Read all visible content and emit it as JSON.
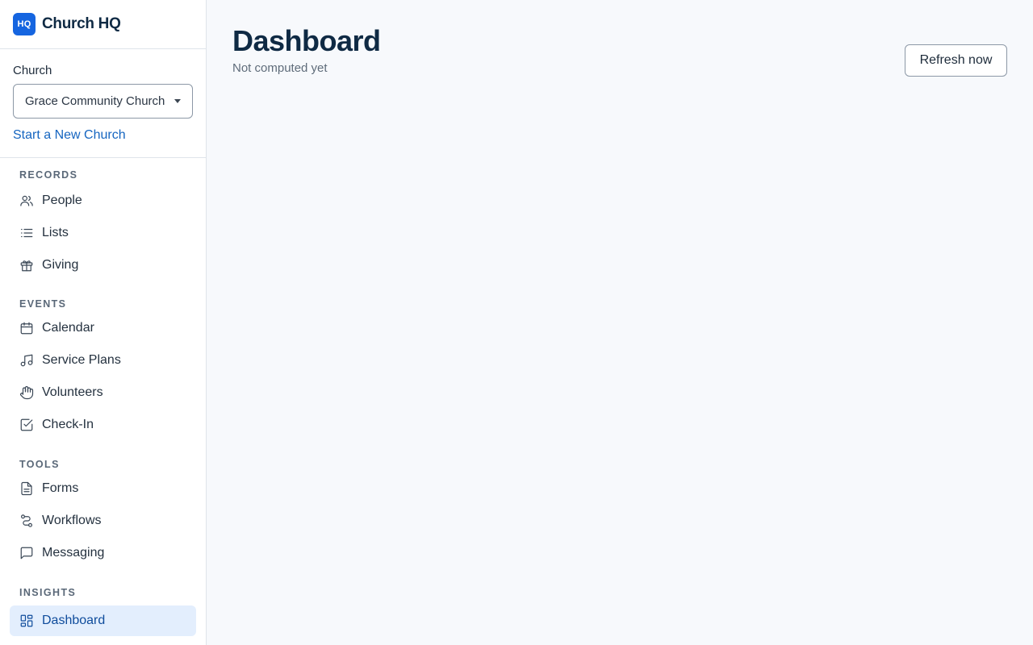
{
  "app": {
    "logo_text": "HQ",
    "name": "Church HQ",
    "brand_color": "#1565e0"
  },
  "church_selector": {
    "label": "Church",
    "value": "Grace Community Church",
    "new_church_link": "Start a New Church"
  },
  "nav": {
    "sections": [
      {
        "title": "RECORDS",
        "items": [
          {
            "label": "People",
            "icon": "people-icon"
          },
          {
            "label": "Lists",
            "icon": "list-icon"
          },
          {
            "label": "Giving",
            "icon": "gift-icon"
          }
        ]
      },
      {
        "title": "EVENTS",
        "items": [
          {
            "label": "Calendar",
            "icon": "calendar-icon"
          },
          {
            "label": "Service Plans",
            "icon": "music-note-icon"
          },
          {
            "label": "Volunteers",
            "icon": "hand-icon"
          },
          {
            "label": "Check-In",
            "icon": "checkbox-icon"
          }
        ]
      },
      {
        "title": "TOOLS",
        "items": [
          {
            "label": "Forms",
            "icon": "document-icon"
          },
          {
            "label": "Workflows",
            "icon": "route-icon"
          },
          {
            "label": "Messaging",
            "icon": "chat-icon"
          }
        ]
      },
      {
        "title": "INSIGHTS",
        "items": [
          {
            "label": "Dashboard",
            "icon": "grid-icon",
            "active": true
          }
        ]
      }
    ]
  },
  "main": {
    "title": "Dashboard",
    "subtitle": "Not computed yet",
    "refresh_label": "Refresh now"
  },
  "colors": {
    "active_bg": "#e3eefd",
    "active_text": "#0f4c9c",
    "link": "#1565c0"
  }
}
